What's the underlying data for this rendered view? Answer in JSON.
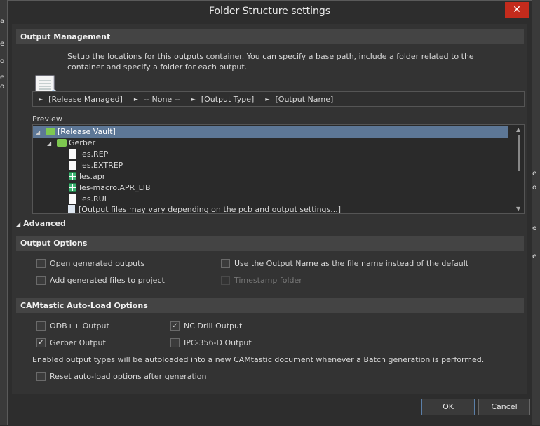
{
  "window": {
    "title": "Folder Structure settings",
    "close_glyph": "✕"
  },
  "output_management": {
    "header": "Output Management",
    "description": "Setup the locations for this outputs container. You can specify a base path, include a folder related to the container and specify a folder for each output.",
    "path_segments": [
      "[Release Managed]",
      "-- None --",
      "[Output Type]",
      "[Output Name]"
    ]
  },
  "preview": {
    "label": "Preview",
    "items": [
      {
        "label": "[Release Vault]",
        "icon": "folder-icon",
        "selected": true
      },
      {
        "label": "Gerber",
        "icon": "folder-icon"
      },
      {
        "label": "les.REP",
        "icon": "file-icon"
      },
      {
        "label": "les.EXTREP",
        "icon": "file-icon"
      },
      {
        "label": "les.apr",
        "icon": "grid-file-icon"
      },
      {
        "label": "les-macro.APR_LIB",
        "icon": "grid-file-icon"
      },
      {
        "label": "les.RUL",
        "icon": "file-icon"
      },
      {
        "label": "[Output files may vary depending on the pcb and output settings...]",
        "icon": "files-icon"
      }
    ]
  },
  "advanced": {
    "label": "Advanced"
  },
  "output_options": {
    "header": "Output Options",
    "open_generated": {
      "label": "Open generated outputs",
      "checked": false
    },
    "add_generated": {
      "label": "Add generated files to project",
      "checked": false
    },
    "use_output_name": {
      "label": "Use the Output Name as the file name instead of the default",
      "checked": false
    },
    "timestamp_folder": {
      "label": "Timestamp folder",
      "checked": false,
      "disabled": true
    }
  },
  "camtastic": {
    "header": "CAMtastic Auto-Load Options",
    "odb": {
      "label": "ODB++ Output",
      "checked": false
    },
    "nc_drill": {
      "label": "NC Drill Output",
      "checked": true
    },
    "gerber": {
      "label": "Gerber Output",
      "checked": true
    },
    "ipc": {
      "label": "IPC-356-D Output",
      "checked": false
    },
    "note": "Enabled output types will be autoloaded into a new CAMtastic  document whenever a Batch generation is performed.",
    "reset": {
      "label": "Reset auto-load options after generation",
      "checked": false
    }
  },
  "buttons": {
    "ok": "OK",
    "cancel": "Cancel"
  },
  "colors": {
    "selection": "#5d7796",
    "close": "#c42b1c",
    "folder": "#7ec850",
    "grid_file": "#3cb371"
  }
}
